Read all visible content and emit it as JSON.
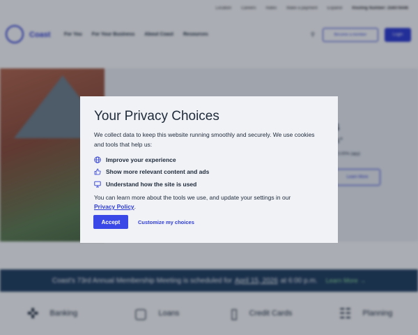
{
  "utility": {
    "links": [
      "Location",
      "Careers",
      "Rates",
      "Make a payment",
      "Espanol",
      "Routing Number: 256078446"
    ]
  },
  "nav": {
    "logo_text": "Coast",
    "items": [
      "For You",
      "For Your Business",
      "About Coast",
      "Resources"
    ],
    "become_member": "Become a member",
    "login": "Login"
  },
  "hero": {
    "line1": "S",
    "line2": "ts°",
    "line3": "at 3.00% (apy)",
    "learn_more": "Learn More"
  },
  "banner": {
    "text": "Coast's 73rd Annual Membership Meeting is scheduled for",
    "date": "April 15, 2026",
    "time": "at 6:00 p.m.",
    "link": "Learn More →"
  },
  "products": [
    {
      "label": "Banking",
      "icon": "✜"
    },
    {
      "label": "Loans",
      "icon": "▢"
    },
    {
      "label": "Credit Cards",
      "icon": "▯"
    },
    {
      "label": "Planning",
      "icon": "☷"
    }
  ],
  "privacy": {
    "title": "Your Privacy Choices",
    "intro": "We collect data to keep this website running smoothly and securely. We use cookies and tools that help us:",
    "items": [
      {
        "icon": "globe-icon",
        "label": "Improve your experience"
      },
      {
        "icon": "thumbs-up-icon",
        "label": "Show more relevant content and ads"
      },
      {
        "icon": "monitor-icon",
        "label": "Understand how the site is used"
      }
    ],
    "more_text": "You can learn more about the tools we use, and update your settings in our",
    "policy_link": "Privacy Policy",
    "period": ".",
    "accept": "Accept",
    "customize": "Customize my choices"
  }
}
